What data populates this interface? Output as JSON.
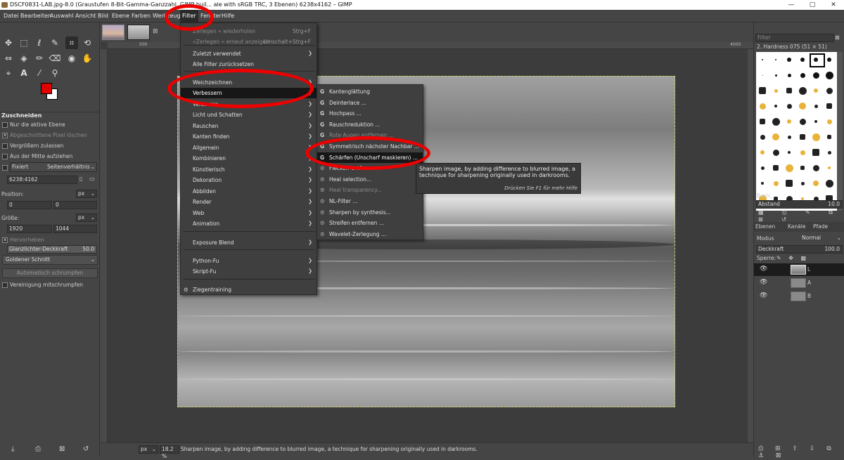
{
  "window": {
    "title": "DSCF0831-LAB.jpg-8.0 (Graustufen 8-Bit-Gamma-Ganzzahl, GIMP buil... ale with sRGB TRC, 3 Ebenen) 6238x4162 – GIMP",
    "min": "—",
    "max": "▢",
    "close": "✕"
  },
  "menubar": [
    "Datei",
    "Bearbeiten",
    "Auswahl",
    "Ansicht",
    "Bild",
    "Ebene",
    "Farben",
    "Werkzeuge",
    "Filter",
    "Fenster",
    "Hilfe"
  ],
  "tool_options": {
    "title": "Zuschneiden",
    "options": [
      {
        "label": "Nur die aktive Ebene",
        "checked": false,
        "enabled": true
      },
      {
        "label": "Abgeschnittene Pixel löschen",
        "checked": true,
        "enabled": false
      },
      {
        "label": "Vergrößern zulassen",
        "checked": false,
        "enabled": true
      },
      {
        "label": "Aus der Mitte aufziehen",
        "checked": false,
        "enabled": true
      }
    ],
    "fixed_label": "Fixiert",
    "fixed_mode": "Seitenverhältnis",
    "ratio": "6238:4162",
    "position_label": "Position:",
    "position_unit": "px",
    "position_x": "0",
    "position_y": "0",
    "size_label": "Größe:",
    "size_unit": "px",
    "size_w": "1920",
    "size_h": "1044",
    "highlight_label": "Hervorheben",
    "highlight_opacity_label": "Glanzlichter-Deckkraft",
    "highlight_opacity": "50.0",
    "guides": "Goldener Schnitt",
    "auto_shrink": "Automatisch schrumpfen",
    "shrink_merged": "Vereinigung mitschrumpfen"
  },
  "filter_menu": {
    "items": [
      {
        "label": "Zerlegen « wiederholen",
        "shortcut": "Strg+F",
        "disabled": true
      },
      {
        "label": "»Zerlegen « erneut anzeigen",
        "shortcut": "Umschalt+Strg+F",
        "disabled": true
      },
      {
        "label": "Zuletzt verwendet",
        "submenu": true
      },
      {
        "label": "Alle Filter zurücksetzen"
      },
      {
        "label": "Weichzeichnen",
        "submenu": true
      },
      {
        "label": "Verbessern",
        "submenu": true,
        "highlight": true
      },
      {
        "label": "Verzerren",
        "submenu": true
      },
      {
        "label": "Licht und Schatten",
        "submenu": true
      },
      {
        "label": "Rauschen",
        "submenu": true
      },
      {
        "label": "Kanten finden",
        "submenu": true
      },
      {
        "label": "Allgemein",
        "submenu": true
      },
      {
        "label": "Kombinieren",
        "submenu": true
      },
      {
        "label": "Künstlerisch",
        "submenu": true
      },
      {
        "label": "Dekoration",
        "submenu": true
      },
      {
        "label": "Abbilden",
        "submenu": true
      },
      {
        "label": "Render",
        "submenu": true
      },
      {
        "label": "Web",
        "submenu": true
      },
      {
        "label": "Animation",
        "submenu": true
      },
      {
        "label": "Exposure Blend",
        "submenu": true
      },
      {
        "label": "Python-Fu",
        "submenu": true
      },
      {
        "label": "Skript-Fu",
        "submenu": true
      },
      {
        "label": "Ziegentraining"
      }
    ]
  },
  "enhance_menu": {
    "items": [
      {
        "label": "Kantenglättung",
        "gegl": true
      },
      {
        "label": "Deinterlace ...",
        "gegl": true
      },
      {
        "label": "Hochpass ...",
        "gegl": true
      },
      {
        "label": "Rauschreduktion ...",
        "gegl": true
      },
      {
        "label": "Rote Augen entfernen ...",
        "gegl": true,
        "disabled": true
      },
      {
        "label": "Symmetrisch nächster Nachbar ...",
        "gegl": true
      },
      {
        "label": "Schärfen (Unscharf maskieren) ...",
        "gegl": true,
        "highlight": true
      },
      {
        "label": "Flecken entfernen",
        "gegl": false
      },
      {
        "label": "Heal selection...",
        "gegl": false
      },
      {
        "label": "Heal transparency...",
        "gegl": false,
        "disabled": true
      },
      {
        "label": "NL-Filter ...",
        "gegl": false
      },
      {
        "label": "Sharpen by synthesis...",
        "gegl": false
      },
      {
        "label": "Streifen entfernen ...",
        "gegl": false
      },
      {
        "label": "Wavelet-Zerlegung ...",
        "gegl": false
      }
    ]
  },
  "tooltip": {
    "text": "Sharpen image, by adding difference to blurred image, a technique for sharpening originally used in darkrooms.",
    "hint": "Drücken Sie F1 für mehr Hilfe"
  },
  "ruler": {
    "mark1": "500",
    "mark2": "4000"
  },
  "status": {
    "unit": "px",
    "zoom": "18.2 %",
    "message": "Sharpen image, by adding difference to blurred image, a technique for sharpening originally used in darkrooms."
  },
  "brushes": {
    "filter_placeholder": "Filter",
    "current": "2. Hardness 075 (51 × 51)",
    "set": "Basic,",
    "spacing_label": "Abstand",
    "spacing": "10.0"
  },
  "layers": {
    "tabs": [
      "Ebenen",
      "Kanäle",
      "Pfade"
    ],
    "mode_label": "Modus",
    "mode": "Normal",
    "opacity_label": "Deckkraft",
    "opacity": "100.0",
    "lock_label": "Sperre:",
    "items": [
      {
        "name": "L",
        "selected": true
      },
      {
        "name": "A",
        "selected": false
      },
      {
        "name": "B",
        "selected": false
      }
    ]
  },
  "colors": {
    "fg": "#e00000",
    "bg": "#ffffff",
    "annotation": "#ee0000"
  }
}
